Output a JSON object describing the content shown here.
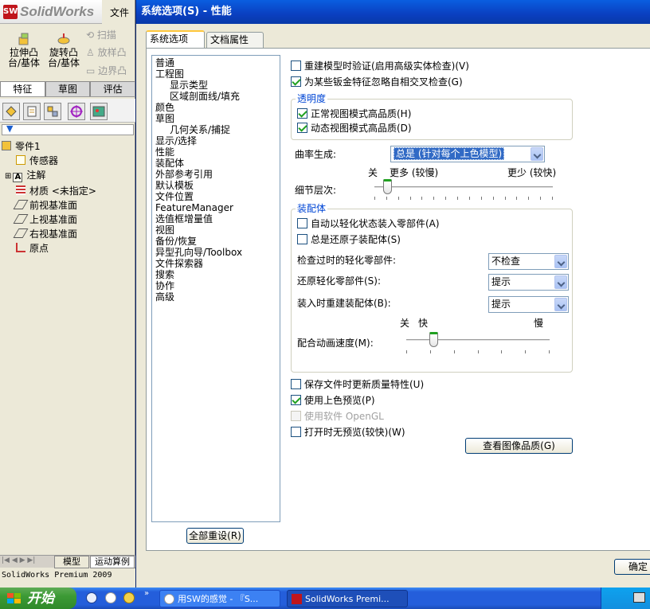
{
  "app": {
    "logo_text": "SolidWorks",
    "logo_mark": "SW",
    "file_menu": "文件",
    "status_bar": "SolidWorks Premium 2009"
  },
  "toolbar": {
    "extrude_label1": "拉伸凸",
    "extrude_label2": "台/基体",
    "revolve_label1": "旋转凸",
    "revolve_label2": "台/基体",
    "sweep": "扫描",
    "loft": "放样凸",
    "boundary": "边界凸"
  },
  "feature_tabs": [
    "特征",
    "草图",
    "评估"
  ],
  "tree": {
    "root": "零件1",
    "items": [
      "传感器",
      "注解",
      "材质 <未指定>",
      "前视基准面",
      "上视基准面",
      "右视基准面",
      "原点"
    ]
  },
  "bottom_tabs": [
    "模型",
    "运动算例"
  ],
  "dialog": {
    "title": "系统选项(S) - 性能",
    "tabs": [
      "系统选项(S)",
      "文档属性(D)"
    ],
    "categories": [
      {
        "label": "普通",
        "indent": false
      },
      {
        "label": "工程图",
        "indent": false
      },
      {
        "label": "显示类型",
        "indent": true
      },
      {
        "label": "区域剖面线/填充",
        "indent": true
      },
      {
        "label": "颜色",
        "indent": false
      },
      {
        "label": "草图",
        "indent": false
      },
      {
        "label": "几何关系/捕捉",
        "indent": true
      },
      {
        "label": "显示/选择",
        "indent": false
      },
      {
        "label": "性能",
        "indent": false
      },
      {
        "label": "装配体",
        "indent": false
      },
      {
        "label": "外部参考引用",
        "indent": false
      },
      {
        "label": "默认模板",
        "indent": false
      },
      {
        "label": "文件位置",
        "indent": false
      },
      {
        "label": "FeatureManager",
        "indent": false
      },
      {
        "label": "选值框增量值",
        "indent": false
      },
      {
        "label": "视图",
        "indent": false
      },
      {
        "label": "备份/恢复",
        "indent": false
      },
      {
        "label": "异型孔向导/Toolbox",
        "indent": false
      },
      {
        "label": "文件探索器",
        "indent": false
      },
      {
        "label": "搜索",
        "indent": false
      },
      {
        "label": "协作",
        "indent": false
      },
      {
        "label": "高级",
        "indent": false
      }
    ],
    "reset_button": "全部重设(R)",
    "ok_button": "确定",
    "rebuild_verify": {
      "label": "重建模型时验证(启用高级实体检查)(V)",
      "checked": false
    },
    "ignore_self_intersect": {
      "label": "为某些钣金特征忽略自相交叉检查(G)",
      "checked": true
    },
    "transparency": {
      "title": "透明度",
      "normal": {
        "label": "正常视图模式高品质(H)",
        "checked": true
      },
      "dynamic": {
        "label": "动态视图模式高品质(D)",
        "checked": true
      }
    },
    "curvature": {
      "label": "曲率生成:",
      "value": "总是 (针对每个上色模型)"
    },
    "lod": {
      "label": "细节层次:",
      "off": "关",
      "more": "更多 (较慢)",
      "less": "更少 (较快)",
      "level": 0.07
    },
    "assemblies": {
      "title": "装配体",
      "auto_lightweight": {
        "label": "自动以轻化状态装入零部件(A)",
        "checked": false
      },
      "always_resolve": {
        "label": "总是还原子装配体(S)",
        "checked": false
      },
      "check_outdated": {
        "label": "检查过时的轻化零部件:",
        "value": "不检查"
      },
      "resolve_lightweight": {
        "label": "还原轻化零部件(S):",
        "value": "提示"
      },
      "rebuild_on_load": {
        "label": "装入时重建装配体(B):",
        "value": "提示"
      },
      "mate_anim": {
        "label": "配合动画速度(M):",
        "off": "关",
        "fast": "快",
        "slow": "慢",
        "level": 0.19
      }
    },
    "update_mass": {
      "label": "保存文件时更新质量特性(U)",
      "checked": false
    },
    "shaded_preview": {
      "label": "使用上色预览(P)",
      "checked": true
    },
    "software_opengl": {
      "label": "使用软件 OpenGL",
      "checked": false,
      "disabled": true
    },
    "no_preview": {
      "label": "打开时无预览(较快)(W)",
      "checked": false
    },
    "image_quality_button": "查看图像品质(G)"
  },
  "taskbar": {
    "start": "开始",
    "tasks": [
      "用SW的感觉 - 『S...",
      "SolidWorks Premi..."
    ],
    "help": "?"
  }
}
